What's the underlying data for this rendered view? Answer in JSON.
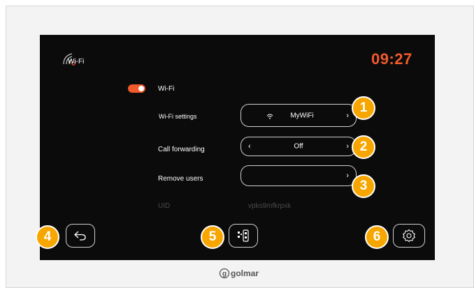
{
  "header": {
    "title": "Wi-Fi",
    "clock": "09:27",
    "icon": "wifi-icon"
  },
  "wifi_toggle": {
    "label": "Wi-Fi",
    "state": "on"
  },
  "rows": {
    "wifi_settings": {
      "label": "Wi-Fi settings",
      "value": "MyWiFi",
      "icon": "wifi-icon",
      "chevron": "›"
    },
    "call_forwarding": {
      "label": "Call forwarding",
      "value": "Off",
      "left_chevron": "‹",
      "right_chevron": "›"
    },
    "remove_users": {
      "label": "Remove users",
      "value": "",
      "chevron": "›"
    },
    "uid": {
      "label": "UID",
      "value": "vpks9mfkrpxk"
    }
  },
  "callouts": [
    "1",
    "2",
    "3",
    "4",
    "5",
    "6"
  ],
  "bottom_bar": {
    "back": "back-arrow-icon",
    "phone_pair": "qr-phone-icon",
    "settings": "gear-icon"
  },
  "brand": {
    "name": "golmar"
  },
  "colors": {
    "accent": "#f15a2b",
    "callout": "#f7a600",
    "screen": "#0b0b0b"
  }
}
